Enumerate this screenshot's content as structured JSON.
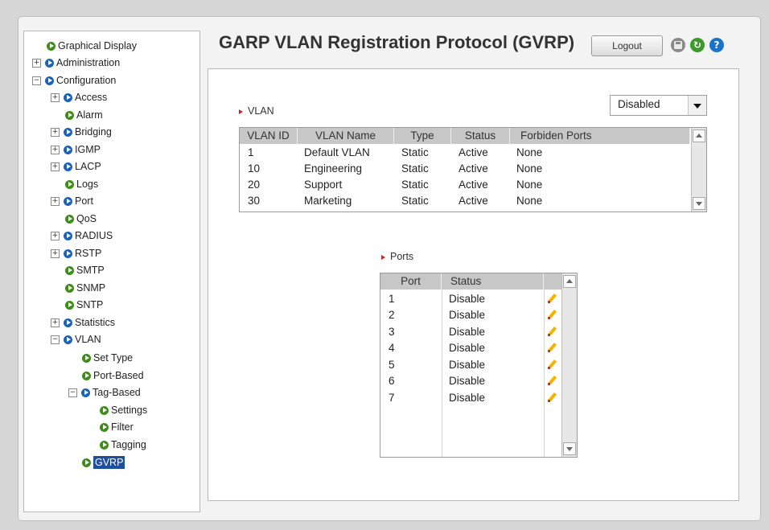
{
  "page": {
    "title": "GARP VLAN Registration Protocol (GVRP)",
    "logout_label": "Logout"
  },
  "nav": {
    "graphical_display": "Graphical Display",
    "administration": "Administration",
    "configuration": "Configuration",
    "access": "Access",
    "alarm": "Alarm",
    "bridging": "Bridging",
    "igmp": "IGMP",
    "lacp": "LACP",
    "logs": "Logs",
    "port": "Port",
    "qos": "QoS",
    "radius": "RADIUS",
    "rstp": "RSTP",
    "smtp": "SMTP",
    "snmp": "SNMP",
    "sntp": "SNTP",
    "statistics": "Statistics",
    "vlan": "VLAN",
    "set_type": "Set Type",
    "port_based": "Port-Based",
    "tag_based": "Tag-Based",
    "settings": "Settings",
    "filter": "Filter",
    "tagging": "Tagging",
    "gvrp": "GVRP"
  },
  "vlan_section": {
    "label": "VLAN",
    "gvrp_state": "Disabled",
    "columns": [
      "VLAN ID",
      "VLAN Name",
      "Type",
      "Status",
      "Forbiden Ports"
    ],
    "rows": [
      [
        "1",
        "Default VLAN",
        "Static",
        "Active",
        "None"
      ],
      [
        "10",
        "Engineering",
        "Static",
        "Active",
        "None"
      ],
      [
        "20",
        "Support",
        "Static",
        "Active",
        "None"
      ],
      [
        "30",
        "Marketing",
        "Static",
        "Active",
        "None"
      ]
    ]
  },
  "ports_section": {
    "label": "Ports",
    "columns": [
      "Port",
      "Status"
    ],
    "rows": [
      [
        "1",
        "Disable"
      ],
      [
        "2",
        "Disable"
      ],
      [
        "3",
        "Disable"
      ],
      [
        "4",
        "Disable"
      ],
      [
        "5",
        "Disable"
      ],
      [
        "6",
        "Disable"
      ],
      [
        "7",
        "Disable"
      ]
    ]
  },
  "icons": {
    "tree_bullet_parent": "blue-arrow-bullet",
    "tree_bullet_leaf": "green-arrow-bullet",
    "save": "save-icon",
    "refresh": "refresh-icon",
    "help": "help-icon",
    "edit": "pencil-icon"
  },
  "colors": {
    "selected_nav": "#1d4ea2",
    "section_marker": "#c42b1c",
    "table_header": "#c7c7c7"
  }
}
